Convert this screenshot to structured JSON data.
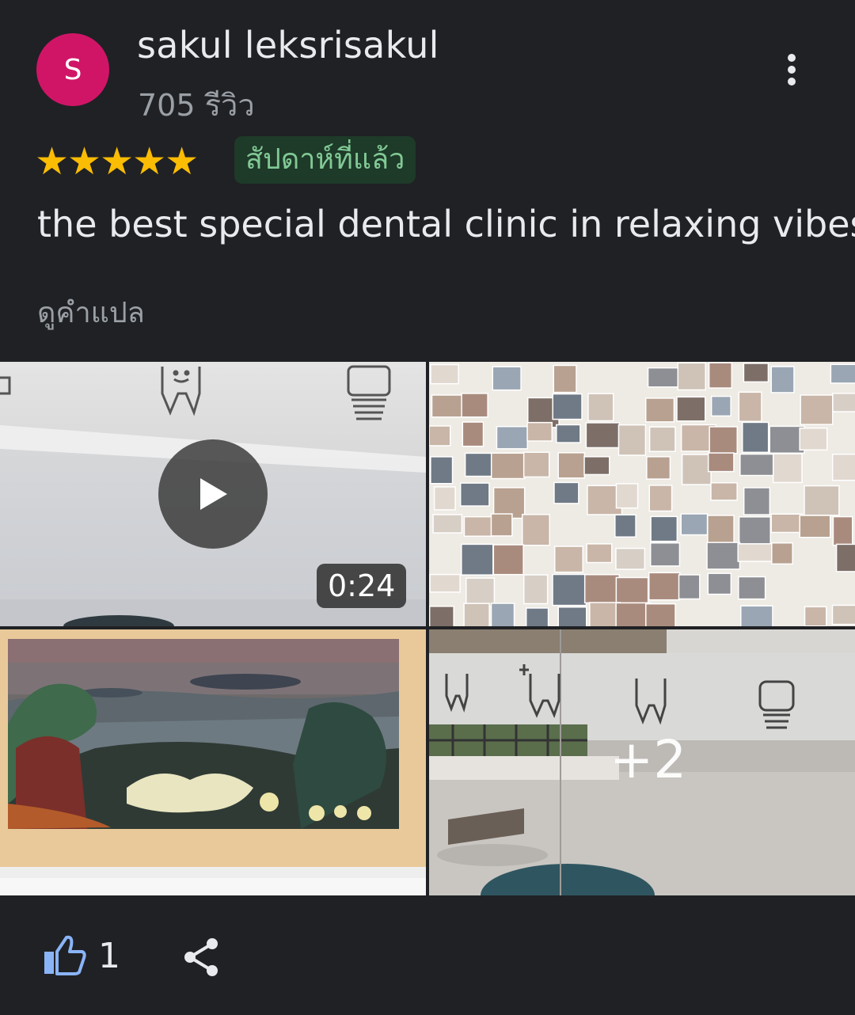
{
  "review": {
    "author_name": "sakul leksrisakul",
    "avatar_initial": "S",
    "review_count": "705 รีวิว",
    "rating": 5,
    "date": "สัปดาห์ที่แล้ว",
    "text": "the best special dental clinic in relaxing vibes",
    "translate_label": "ดูคำแปล"
  },
  "media": {
    "video_duration": "0:24",
    "more_count": "+2",
    "photos": [
      "video-thumbnail",
      "photo-wall",
      "landscape-painting",
      "clinic-glass-window"
    ]
  },
  "actions": {
    "like_count": "1"
  },
  "colors": {
    "background": "#202124",
    "avatar": "#d01567",
    "star": "#fbbc04",
    "badge_bg": "#1e3a29",
    "badge_text": "#81c995",
    "like_icon": "#8ab4f8",
    "muted_text": "#9aa0a6"
  },
  "icons": {
    "more": "more-vert-icon",
    "star": "star-icon",
    "play": "play-icon",
    "like": "thumb-up-icon",
    "share": "share-icon"
  }
}
